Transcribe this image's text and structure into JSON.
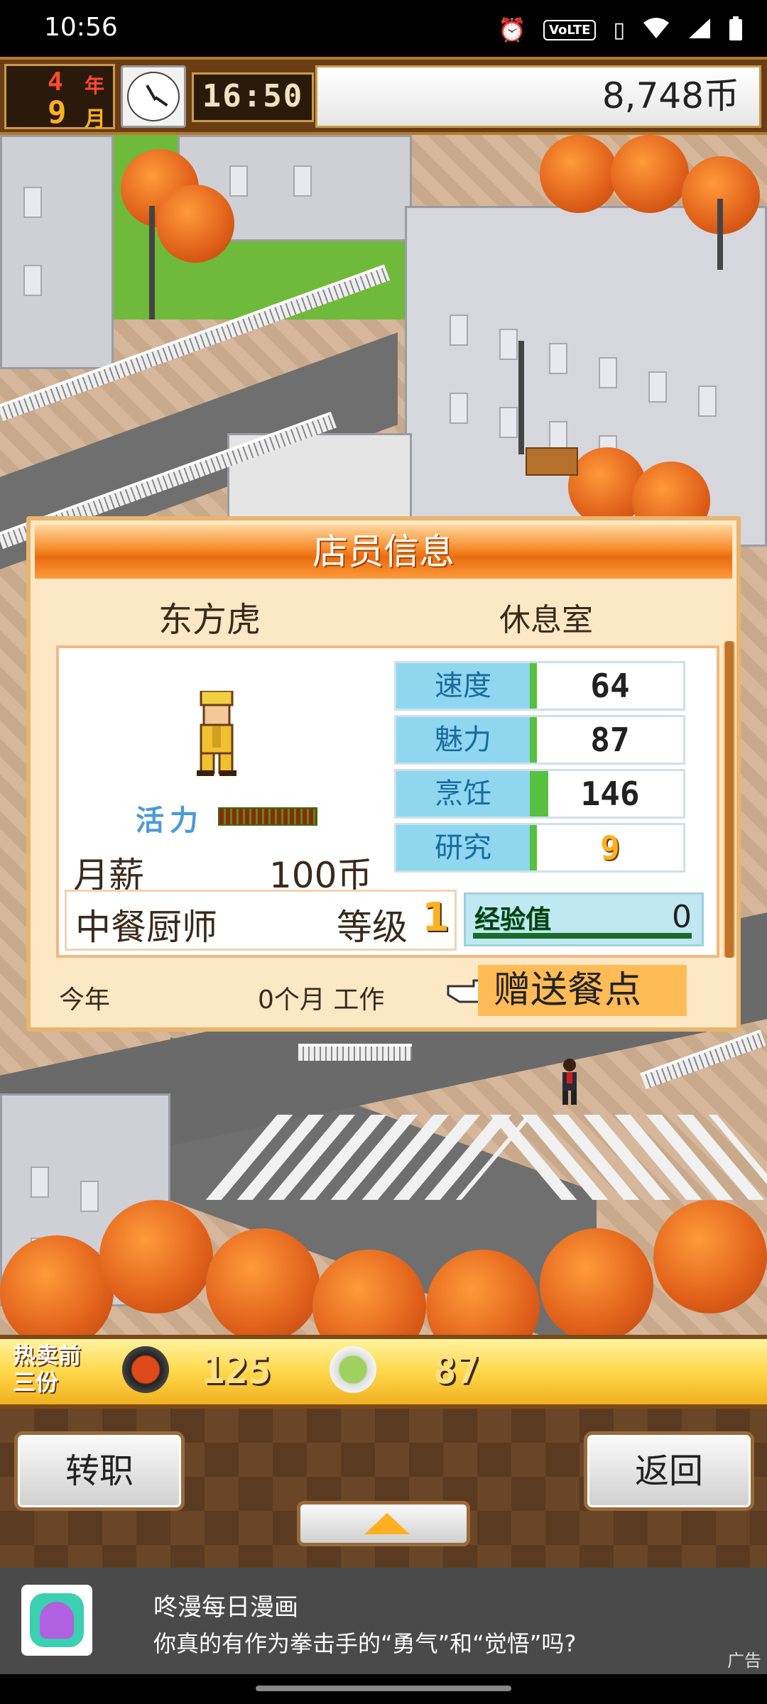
{
  "status_bar": {
    "time": "10:56",
    "volte": "VoLTE"
  },
  "hud": {
    "year_num": "4",
    "year_unit": "年",
    "month_num": "9",
    "month_unit": "月",
    "game_time": "16:50",
    "money": "8,748币"
  },
  "dialog": {
    "title": "店员信息",
    "staff_name": "东方虎",
    "location": "休息室",
    "vitality_label": "活力",
    "salary_label": "月薪",
    "salary_value": "100币",
    "stats": [
      {
        "label": "速度",
        "value": "64"
      },
      {
        "label": "魅力",
        "value": "87"
      },
      {
        "label": "烹饪",
        "value": "146"
      },
      {
        "label": "研究",
        "value": "9"
      }
    ],
    "job_title": "中餐厨师",
    "level_label": "等级",
    "level_value": "1",
    "exp_label": "经验值",
    "exp_value": "0",
    "footer_year": "今年",
    "footer_work": "0个月 工作",
    "gift_button": "赠送餐点"
  },
  "bestsellers": {
    "label": "热卖前三份",
    "items": [
      {
        "icon": "rice-bowl-icon",
        "count": "125"
      },
      {
        "icon": "salad-plate-icon",
        "count": "87"
      }
    ]
  },
  "buttons": {
    "transfer": "转职",
    "back": "返回"
  },
  "ad": {
    "app_name": "咚漫每日漫画",
    "text": "你真的有作为拳击手的“勇气”和“觉悟”吗?",
    "tag": "广告"
  },
  "colors": {
    "accent_orange": "#f78a2a",
    "stat_blue": "#8fd7ef",
    "gift_orange": "#ffbb55"
  }
}
